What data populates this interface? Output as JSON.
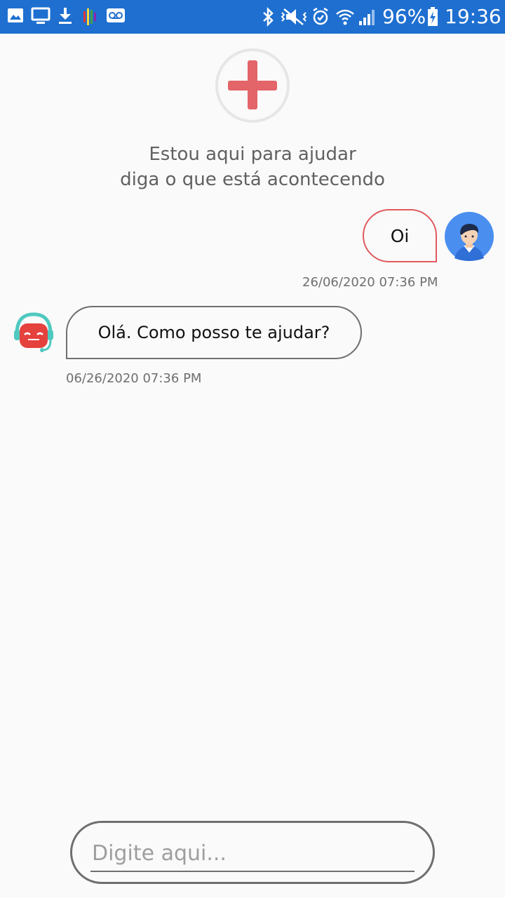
{
  "status_bar": {
    "battery": "96%",
    "time": "19:36",
    "icons": [
      "image-icon",
      "monitor-icon",
      "download-icon",
      "app-colorful-icon",
      "voicemail-icon",
      "bluetooth-icon",
      "mute-icon",
      "alarm-icon",
      "wifi-icon",
      "signal-icon",
      "battery-charging-icon"
    ],
    "color": "#1e6fd0"
  },
  "header": {
    "logo_icon": "red-cross-icon",
    "line1": "Estou aqui para ajudar",
    "line2": "diga o que está acontecendo"
  },
  "messages": [
    {
      "sender": "user",
      "text": "Oi",
      "timestamp": "26/06/2020 07:36 PM",
      "avatar_icon": "user-avatar-icon",
      "border_color": "#e05a5f"
    },
    {
      "sender": "bot",
      "text": "Olá. Como posso te ajudar?",
      "timestamp": "06/26/2020 07:36 PM",
      "avatar_icon": "bot-headset-icon",
      "border_color": "#707070"
    }
  ],
  "composer": {
    "placeholder": "Digite aqui...",
    "value": ""
  },
  "colors": {
    "accent_red": "#e05a5f",
    "avatar_blue": "#4a8ef0",
    "bot_teal": "#4fc9c0"
  }
}
